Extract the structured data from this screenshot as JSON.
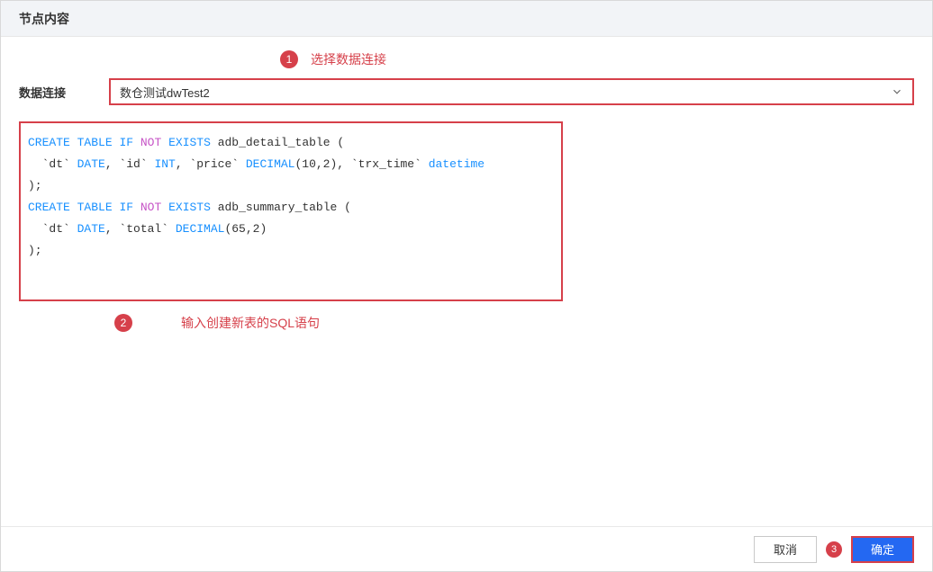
{
  "header": {
    "title": "节点内容"
  },
  "annotations": {
    "num1": "1",
    "text1": "选择数据连接",
    "num2": "2",
    "text2": "输入创建新表的SQL语句",
    "num3": "3"
  },
  "form": {
    "connection_label": "数据连接",
    "connection_value": "数仓测试dwTest2"
  },
  "sql": {
    "kw_create": "CREATE",
    "kw_table": "TABLE",
    "kw_if": "IF",
    "kw_not": "NOT",
    "kw_exists": "EXISTS",
    "kw_date": "DATE",
    "kw_int": "INT",
    "kw_decimal": "DECIMAL",
    "kw_datetime": "datetime",
    "line1_tail": " adb_detail_table (",
    "line2_dt": "  `dt` ",
    "line2_id": ", `id` ",
    "line2_price": ", `price` ",
    "line2_dec_arg": "(10,2)",
    "line2_trx": ", `trx_time` ",
    "close_paren": ");",
    "line4_tail": " adb_summary_table (",
    "line5_dt": "  `dt` ",
    "line5_total": ", `total` ",
    "line5_dec_arg": "(65,2)"
  },
  "footer": {
    "cancel": "取消",
    "confirm": "确定"
  }
}
